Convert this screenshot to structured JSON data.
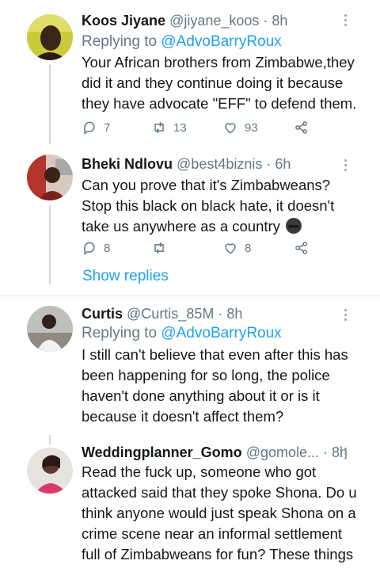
{
  "tweets": [
    {
      "name": "Koos Jiyane",
      "handle": "@jiyane_koos",
      "time": "· 8h",
      "reply_prefix": "Replying to",
      "reply_to": "@AdvoBarryRoux",
      "text": "Your African brothers from Zimbabwe,they did it and they continue doing it because they have advocate \"EFF\" to defend them.",
      "replies": "7",
      "retweets": "13",
      "likes": "93"
    },
    {
      "name": "Bheki Ndlovu",
      "handle": "@best4biznis",
      "time": "· 6h",
      "text": "Can you prove that it's Zimbabweans? Stop this black on black hate, it doesn't take us anywhere as a country",
      "emoji": "man-in-hat-emoji",
      "replies": "8",
      "retweets": "",
      "likes": "8"
    },
    {
      "name": "Curtis",
      "handle": "@Curtis_85M",
      "time": "· 8h",
      "reply_prefix": "Replying to",
      "reply_to": "@AdvoBarryRoux",
      "text": "I still can't believe that even after this has been happening for so long, the police haven't done anything about it or is it because it doesn't affect them?"
    },
    {
      "name": "Weddingplanner_Gomo",
      "handle": "@gomole...",
      "time": "· 8h",
      "text": "Read the fuck up, someone who got attacked said that they spoke Shona. Do u think anyone would just speak Shona on a crime scene near an informal settlement full of Zimbabweans for fun? These things"
    }
  ],
  "show_replies": "Show replies",
  "colors": {
    "accent": "#1da1f2",
    "muted": "#657786",
    "text": "#14171a",
    "divider": "#e1e8ed"
  }
}
